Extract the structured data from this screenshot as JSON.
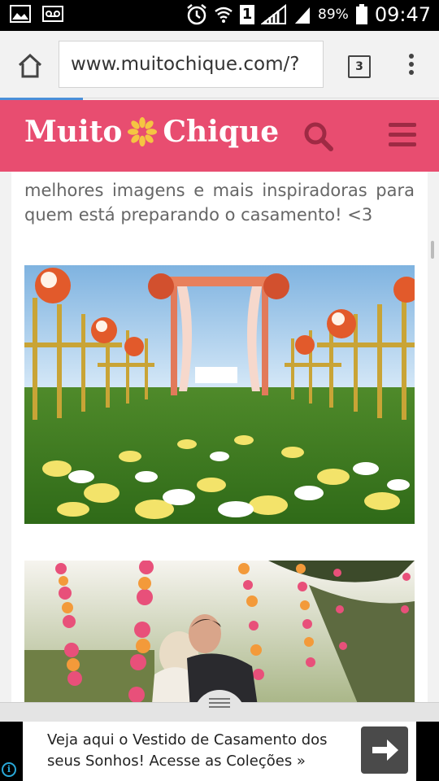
{
  "status_bar": {
    "battery_percent": "89%",
    "time": "09:47",
    "sim_slot": "1",
    "icons": [
      "image-icon",
      "voicemail-icon",
      "alarm-icon",
      "wifi-icon",
      "sim-1-icon",
      "signal-icon",
      "signal-icon-2",
      "battery-icon"
    ]
  },
  "browser": {
    "url": "www.muitochique.com/?",
    "tab_count": "3",
    "progress": 0.19
  },
  "site": {
    "brand_left": "Muito",
    "brand_right": "Chique",
    "brand_color": "#e84d70"
  },
  "article": {
    "intro_text": "melhores imagens e mais inspiradoras para quem está preparando o casamento! <3"
  },
  "ad": {
    "text": "Veja aqui o Vestido de Casamento dos seus Sonhos! Acesse as Coleções »",
    "info_symbol": "i"
  }
}
